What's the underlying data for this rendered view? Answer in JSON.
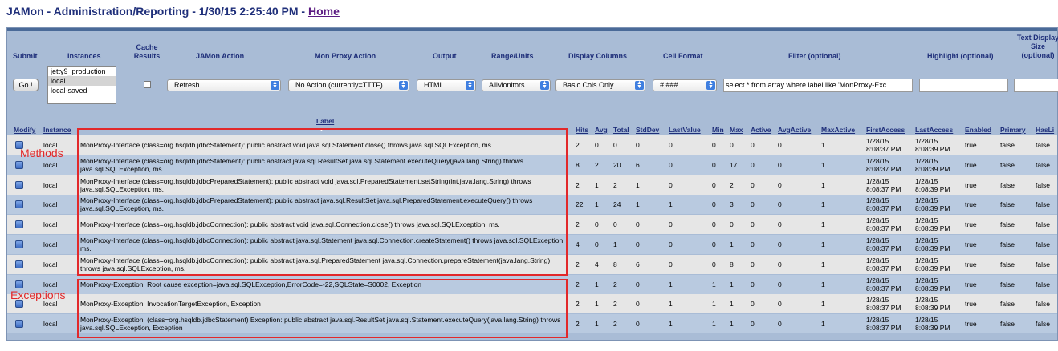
{
  "page": {
    "title_prefix": "JAMon - Administration/Reporting - 1/30/15 2:25:40 PM - ",
    "home_link": "Home"
  },
  "controls": {
    "headers": [
      "Submit",
      "Instances",
      "Cache",
      "Results",
      "JAMon Action",
      "Mon Proxy Action",
      "Output",
      "Range/Units",
      "Display Columns",
      "Cell Format",
      "Filter (optional)",
      "Highlight (optional)",
      "Text Display",
      "Size",
      "(optional)"
    ],
    "go_label": "Go !",
    "instances": [
      "jetty9_production",
      "local",
      "local-saved"
    ],
    "instances_selected": "local",
    "cache_results_checked": false,
    "jamon_action": "Refresh",
    "mon_proxy_action": "No Action (currently=TTTF)",
    "output": "HTML",
    "range_units": "AllMonitors",
    "display_columns": "Basic Cols Only",
    "cell_format": "#,###",
    "filter_value": "select * from array where label like 'MonProxy-Exc",
    "highlight_value": "",
    "text_display_size_value": ""
  },
  "table": {
    "columns": [
      "Modify",
      "Instance",
      "Label",
      "Hits",
      "Avg",
      "Total",
      "StdDev",
      "LastValue",
      "Min",
      "Max",
      "Active",
      "AvgActive",
      "MaxActive",
      "FirstAccess",
      "LastAccess",
      "Enabled",
      "Primary",
      "HasLi"
    ],
    "rows": [
      {
        "instance": "local",
        "label": "MonProxy-Interface (class=org.hsqldb.jdbcStatement): public abstract void java.sql.Statement.close() throws java.sql.SQLException, ms.",
        "hits": "2",
        "avg": "0",
        "total": "0",
        "stddev": "0",
        "lastvalue": "0",
        "min": "0",
        "max": "0",
        "active": "0",
        "avgactive": "0",
        "maxactive": "1",
        "first1": "1/28/15",
        "first2": "8:08:37 PM",
        "last1": "1/28/15",
        "last2": "8:08:39 PM",
        "enabled": "true",
        "primary": "false",
        "hasli": "false"
      },
      {
        "instance": "local",
        "label": "MonProxy-Interface (class=org.hsqldb.jdbcStatement): public abstract java.sql.ResultSet java.sql.Statement.executeQuery(java.lang.String) throws java.sql.SQLException, ms.",
        "hits": "8",
        "avg": "2",
        "total": "20",
        "stddev": "6",
        "lastvalue": "0",
        "min": "0",
        "max": "17",
        "active": "0",
        "avgactive": "0",
        "maxactive": "1",
        "first1": "1/28/15",
        "first2": "8:08:37 PM",
        "last1": "1/28/15",
        "last2": "8:08:39 PM",
        "enabled": "true",
        "primary": "false",
        "hasli": "false"
      },
      {
        "instance": "local",
        "label": "MonProxy-Interface (class=org.hsqldb.jdbcPreparedStatement): public abstract void java.sql.PreparedStatement.setString(int,java.lang.String) throws java.sql.SQLException, ms.",
        "hits": "2",
        "avg": "1",
        "total": "2",
        "stddev": "1",
        "lastvalue": "0",
        "min": "0",
        "max": "2",
        "active": "0",
        "avgactive": "0",
        "maxactive": "1",
        "first1": "1/28/15",
        "first2": "8:08:37 PM",
        "last1": "1/28/15",
        "last2": "8:08:39 PM",
        "enabled": "true",
        "primary": "false",
        "hasli": "false"
      },
      {
        "instance": "local",
        "label": "MonProxy-Interface (class=org.hsqldb.jdbcPreparedStatement): public abstract java.sql.ResultSet java.sql.PreparedStatement.executeQuery() throws java.sql.SQLException, ms.",
        "hits": "22",
        "avg": "1",
        "total": "24",
        "stddev": "1",
        "lastvalue": "1",
        "min": "0",
        "max": "3",
        "active": "0",
        "avgactive": "0",
        "maxactive": "1",
        "first1": "1/28/15",
        "first2": "8:08:37 PM",
        "last1": "1/28/15",
        "last2": "8:08:39 PM",
        "enabled": "true",
        "primary": "false",
        "hasli": "false"
      },
      {
        "instance": "local",
        "label": "MonProxy-Interface (class=org.hsqldb.jdbcConnection): public abstract void java.sql.Connection.close() throws java.sql.SQLException, ms.",
        "hits": "2",
        "avg": "0",
        "total": "0",
        "stddev": "0",
        "lastvalue": "0",
        "min": "0",
        "max": "0",
        "active": "0",
        "avgactive": "0",
        "maxactive": "1",
        "first1": "1/28/15",
        "first2": "8:08:37 PM",
        "last1": "1/28/15",
        "last2": "8:08:39 PM",
        "enabled": "true",
        "primary": "false",
        "hasli": "false"
      },
      {
        "instance": "local",
        "label": "MonProxy-Interface (class=org.hsqldb.jdbcConnection): public abstract java.sql.Statement java.sql.Connection.createStatement() throws java.sql.SQLException, ms.",
        "hits": "4",
        "avg": "0",
        "total": "1",
        "stddev": "0",
        "lastvalue": "0",
        "min": "0",
        "max": "1",
        "active": "0",
        "avgactive": "0",
        "maxactive": "1",
        "first1": "1/28/15",
        "first2": "8:08:37 PM",
        "last1": "1/28/15",
        "last2": "8:08:39 PM",
        "enabled": "true",
        "primary": "false",
        "hasli": "false"
      },
      {
        "instance": "local",
        "label": "MonProxy-Interface (class=org.hsqldb.jdbcConnection): public abstract java.sql.PreparedStatement java.sql.Connection.prepareStatement(java.lang.String) throws java.sql.SQLException, ms.",
        "hits": "2",
        "avg": "4",
        "total": "8",
        "stddev": "6",
        "lastvalue": "0",
        "min": "0",
        "max": "8",
        "active": "0",
        "avgactive": "0",
        "maxactive": "1",
        "first1": "1/28/15",
        "first2": "8:08:37 PM",
        "last1": "1/28/15",
        "last2": "8:08:39 PM",
        "enabled": "true",
        "primary": "false",
        "hasli": "false"
      },
      {
        "instance": "local",
        "label": "MonProxy-Exception: Root cause exception=java.sql.SQLException,ErrorCode=-22,SQLState=S0002, Exception",
        "hits": "2",
        "avg": "1",
        "total": "2",
        "stddev": "0",
        "lastvalue": "1",
        "min": "1",
        "max": "1",
        "active": "0",
        "avgactive": "0",
        "maxactive": "1",
        "first1": "1/28/15",
        "first2": "8:08:37 PM",
        "last1": "1/28/15",
        "last2": "8:08:39 PM",
        "enabled": "true",
        "primary": "false",
        "hasli": "false"
      },
      {
        "instance": "local",
        "label": "MonProxy-Exception: InvocationTargetException, Exception",
        "hits": "2",
        "avg": "1",
        "total": "2",
        "stddev": "0",
        "lastvalue": "1",
        "min": "1",
        "max": "1",
        "active": "0",
        "avgactive": "0",
        "maxactive": "1",
        "first1": "1/28/15",
        "first2": "8:08:37 PM",
        "last1": "1/28/15",
        "last2": "8:08:39 PM",
        "enabled": "true",
        "primary": "false",
        "hasli": "false"
      },
      {
        "instance": "local",
        "label": "MonProxy-Exception: (class=org.hsqldb.jdbcStatement) Exception: public abstract java.sql.ResultSet java.sql.Statement.executeQuery(java.lang.String) throws java.sql.SQLException, Exception",
        "hits": "2",
        "avg": "1",
        "total": "2",
        "stddev": "0",
        "lastvalue": "1",
        "min": "1",
        "max": "1",
        "active": "0",
        "avgactive": "0",
        "maxactive": "1",
        "first1": "1/28/15",
        "first2": "8:08:37 PM",
        "last1": "1/28/15",
        "last2": "8:08:39 PM",
        "enabled": "true",
        "primary": "false",
        "hasli": "false"
      }
    ]
  },
  "annotations": {
    "methods": "Methods",
    "exceptions": "Exceptions"
  },
  "colors": {
    "header_text": "#1f2f7a",
    "panel_bg": "#a9bcd6",
    "row_odd": "#e6e6e6",
    "row_even": "#b9cae0",
    "annotation_red": "#e2282a"
  },
  "icons": {
    "modify": "modify-icon",
    "select_arrow": "chevron-updown-icon",
    "sort": "sort-down-icon"
  }
}
